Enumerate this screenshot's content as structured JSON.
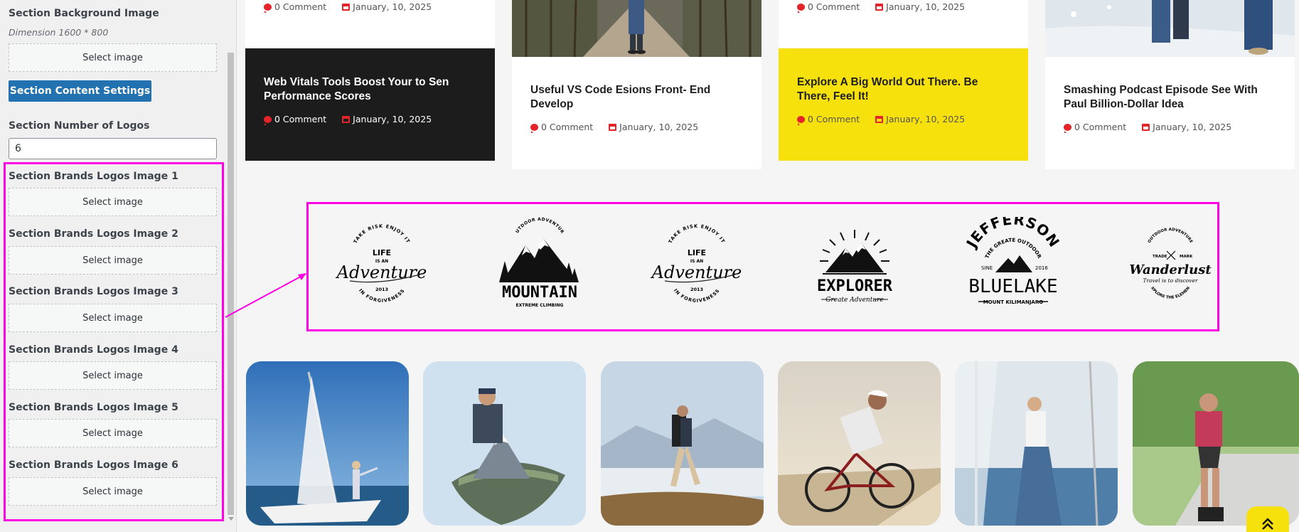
{
  "panel": {
    "bg_label": "Section Background Image",
    "bg_dimension": "Dimension 1600 * 800",
    "select_label": "Select image",
    "content_settings_button": "Section Content Settings",
    "num_logos_label": "Section Number of Logos",
    "num_logos_value": "6",
    "logo_fields": [
      {
        "label": "Section Brands Logos Image 1"
      },
      {
        "label": "Section Brands Logos Image 2"
      },
      {
        "label": "Section Brands Logos Image 3"
      },
      {
        "label": "Section Brands Logos Image 4"
      },
      {
        "label": "Section Brands Logos Image 5"
      },
      {
        "label": "Section Brands Logos Image 6"
      }
    ]
  },
  "posts": {
    "top_meta": [
      {
        "comments": "0 Comment",
        "date": "January, 10, 2025"
      },
      {
        "comments": "0 Comment",
        "date": "January, 10, 2025"
      }
    ],
    "cards": [
      {
        "title": "Web Vitals Tools Boost Your to Sen Performance Scores",
        "comments": "0 Comment",
        "date": "January, 10, 2025",
        "style": "dark"
      },
      {
        "title": "Useful VS Code Esions Front- End Develop",
        "comments": "0 Comment",
        "date": "January, 10, 2025",
        "style": "light"
      },
      {
        "title": "Explore A Big World Out There. Be There, Feel It!",
        "comments": "0 Comment",
        "date": "January, 10, 2025",
        "style": "yellow"
      },
      {
        "title": "Smashing Podcast Episode See With Paul Billion-Dollar Idea",
        "comments": "0 Comment",
        "date": "January, 10, 2025",
        "style": "light"
      }
    ]
  },
  "logos": {
    "adventure": {
      "top_arc": "TAKE RISK ENJOY IT",
      "line1": "LIFE",
      "line2": "IS AN",
      "script": "Adventure",
      "year": "2013",
      "bottom_arc": "IN FORGIVENESS"
    },
    "mountain": {
      "top_arc": "OUTDOOR ADVENTURE",
      "name": "MOUNTAIN",
      "tag": "EXTREME CLIMBING"
    },
    "explorer": {
      "name": "EXPLORER",
      "tag": "Greate Adventure"
    },
    "jefferson": {
      "top": "JEFFERSON",
      "arc": "THE GREATE OUTDOOR",
      "since": "SINE",
      "year": "2016",
      "name": "BLUELAKE",
      "tag": "MOUNT KILIMANJARO"
    },
    "wanderlust": {
      "top_arc": "OUTDOOR ADVENTURE",
      "left": "TRADE",
      "right": "MARK",
      "name": "Wanderlust",
      "tag": "Travel is to discover",
      "bottom_arc": "EXPLORE THE ELEMENT"
    }
  },
  "colors": {
    "highlight": "#ff00e6",
    "accent_red": "#e5242a",
    "yellow": "#f7e10d",
    "button_blue": "#2271b1",
    "dark_card": "#1c1c1c"
  },
  "icons": {
    "comment": "comment-icon",
    "calendar": "calendar-icon",
    "scroll_top": "double-chevron-up-icon"
  }
}
